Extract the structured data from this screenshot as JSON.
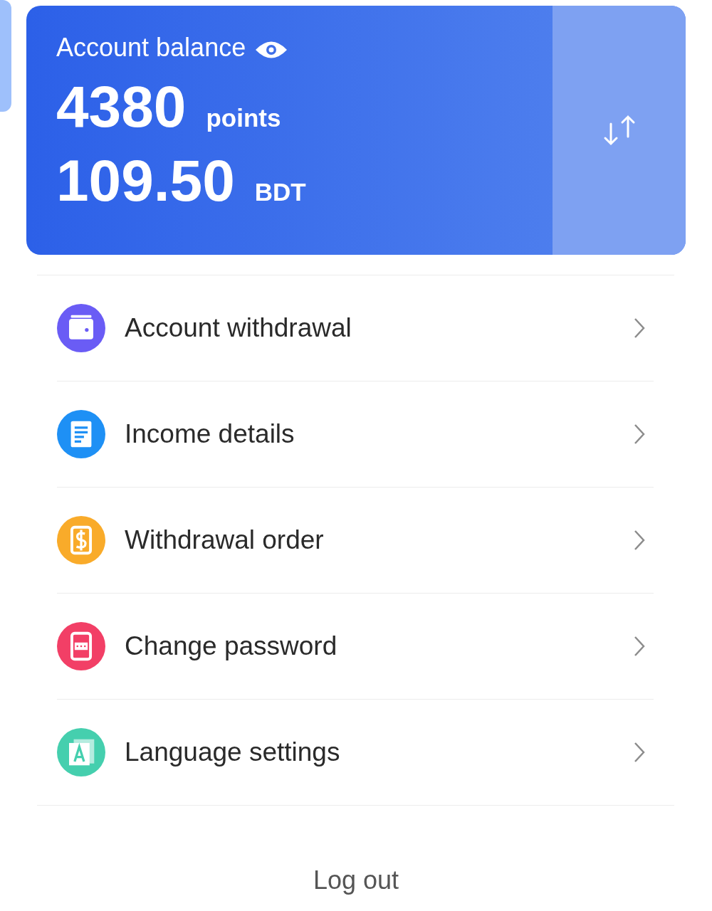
{
  "balance_card": {
    "title": "Account balance",
    "points": "4380",
    "points_unit": "points",
    "amount": "109.50",
    "currency": "BDT"
  },
  "menu": [
    {
      "label": "Account withdrawal",
      "kind": "wallet",
      "color": "#6a5cf5"
    },
    {
      "label": "Income details",
      "kind": "document",
      "color": "#1e90f5"
    },
    {
      "label": "Withdrawal order",
      "kind": "money",
      "color": "#f9ab2a"
    },
    {
      "label": "Change password",
      "kind": "password",
      "color": "#f23f66"
    },
    {
      "label": "Language settings",
      "kind": "language",
      "color": "#45cfae"
    }
  ],
  "logout": "Log out"
}
